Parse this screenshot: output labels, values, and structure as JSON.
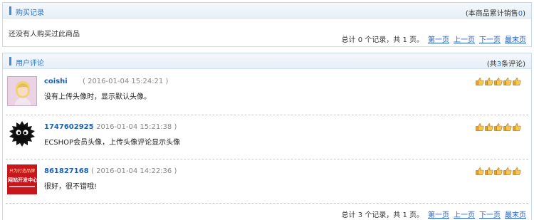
{
  "purchase": {
    "title": "购买记录",
    "sales_prefix": "(本商品累计销售",
    "sales_count": "0",
    "sales_suffix": ")",
    "empty_message": "还没有人购买过此商品",
    "pager": {
      "summary": "总计 0 个记录，共 1 页。",
      "first": "第一页",
      "prev": "上一页",
      "next": "下一页",
      "last": "最末页"
    }
  },
  "comments": {
    "title": "用户评论",
    "count_prefix": "(共",
    "count": "3",
    "count_suffix": "条评论)",
    "items": [
      {
        "user": "coishi",
        "time": "( 2016-01-04 15:24:21 )",
        "text": "没有上传头像时，显示默认头像。",
        "rating": 5,
        "avatar": "default-avatar"
      },
      {
        "user": "1747602925",
        "time": "( 2016-01-04 15:21:38 )",
        "text": "ECSHOP会员头像，上传头像评论显示头像",
        "rating": 5,
        "avatar": "furball-avatar"
      },
      {
        "user": "861827168",
        "time": "( 2016-01-04 14:22:36 )",
        "text": "很好，很不错哦!",
        "rating": 5,
        "avatar": "brand-avatar",
        "avatar_text_top": "只为打造品牌",
        "avatar_text_main": "网站开发中心"
      }
    ],
    "pager": {
      "summary": "总计 3 个记录，共 1 页。",
      "first": "第一页",
      "prev": "上一页",
      "next": "下一页",
      "last": "最末页"
    }
  },
  "colors": {
    "title_blue": "#2f73c1",
    "link_blue": "#1f5fc6",
    "star_gold": "#f0b030"
  }
}
